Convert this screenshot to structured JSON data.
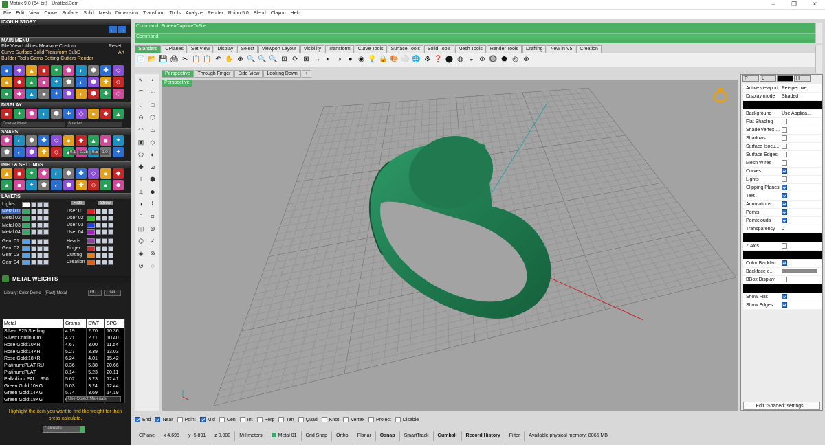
{
  "title": "Matrix 9.0 (64-bit) - Untitled.3dm",
  "window_controls": [
    "–",
    "❐",
    "✕"
  ],
  "menu": [
    "File",
    "Edit",
    "View",
    "Curve",
    "Surface",
    "Solid",
    "Mesh",
    "Dimension",
    "Transform",
    "Tools",
    "Analyze",
    "Render",
    "Rhino 5.0",
    "Blend",
    "Clayoo",
    "Help"
  ],
  "left": {
    "icon_history": "ICON HISTORY",
    "main_menu": "MAIN MENU",
    "main_menu_rows": [
      "File  View  Utilities  Measure  Custom",
      "Curve  Surface  Solid  Transform  SubD",
      "Builder  Tools  Gems  Setting  Cutters  Render"
    ],
    "main_menu_reset": "Reset",
    "main_menu_art": "Art",
    "display": "DISPLAY",
    "display_fields": [
      "Coarse Mesh",
      "Shaded"
    ],
    "snaps": "SNAPS",
    "snap_values": [
      "0.1",
      "0.25",
      "0.5",
      "1.0"
    ],
    "info_settings": "INFO & SETTINGS",
    "layers": "LAYERS",
    "layers_hide": "Hide",
    "layers_show": "Show",
    "layers_left": [
      {
        "name": "Lights",
        "color": "#ffffff",
        "sel": false
      },
      {
        "name": "Metal 01",
        "color": "#3aa66a",
        "sel": true
      },
      {
        "name": "Metal 02",
        "color": "#3aa66a",
        "sel": false
      },
      {
        "name": "Metal 03",
        "color": "#3aa66a",
        "sel": false
      },
      {
        "name": "Metal 04",
        "color": "#3aa66a",
        "sel": false
      },
      {
        "name": "Gem 01",
        "color": "#5aa0e0",
        "sel": false
      },
      {
        "name": "Gem 02",
        "color": "#5aa0e0",
        "sel": false
      },
      {
        "name": "Gem 03",
        "color": "#5aa0e0",
        "sel": false
      },
      {
        "name": "Gem 04",
        "color": "#5aa0e0",
        "sel": false
      }
    ],
    "layers_right": [
      {
        "name": "User 01",
        "color": "#e02020"
      },
      {
        "name": "User 02",
        "color": "#20c020"
      },
      {
        "name": "User 03",
        "color": "#2040e0"
      },
      {
        "name": "User 04",
        "color": "#a020c0"
      },
      {
        "name": "Heads",
        "color": "#9040a0"
      },
      {
        "name": "Finger",
        "color": "#c03030"
      },
      {
        "name": "Cutting",
        "color": "#e08020"
      },
      {
        "name": "Creation",
        "color": "#e06010"
      }
    ],
    "metal_weights": "METAL WEIGHTS",
    "mw_library": "Library: Color Dome - (Fast)-Metal",
    "mw_unit1": "GU",
    "mw_unit2": "User",
    "mw_headers": [
      "Metal",
      "Grams",
      "DWT",
      "SPG"
    ],
    "mw_rows": [
      [
        "Silver:.925 Sterling",
        "4.19",
        "2.70",
        "10.36"
      ],
      [
        "Silver:Continuum",
        "4.21",
        "2.71",
        "10.40"
      ],
      [
        "Rose Gold:10KR",
        "4.67",
        "3.00",
        "11.54"
      ],
      [
        "Rose Gold:14KR",
        "5.27",
        "3.39",
        "13.03"
      ],
      [
        "Rose Gold:18KR",
        "6.24",
        "4.01",
        "15.42"
      ],
      [
        "Platinum:PLAT RU",
        "8.36",
        "5.38",
        "20.66"
      ],
      [
        "Platinum:PLAT",
        "8.14",
        "5.23",
        "20.11"
      ],
      [
        "Palladium:PALL .950",
        "5.02",
        "3.23",
        "12.41"
      ],
      [
        "Green Gold:10KG",
        "5.03",
        "3.24",
        "12.44"
      ],
      [
        "Green Gold:14KG",
        "5.74",
        "3.69",
        "14.19"
      ],
      [
        "Green Gold:18KG",
        "6.44",
        "4.14",
        "15.92"
      ]
    ],
    "use_object_materials": "Use Object Materials",
    "highlight_text": "Highlight the item you want to find the weight for then press calculate.",
    "calculate": "Calculate"
  },
  "command": {
    "line1": "Command: ScreenCaptureToFile",
    "line2": "Command:"
  },
  "tabs": [
    "Standard",
    "CPlanes",
    "Set View",
    "Display",
    "Select",
    "Viewport Layout",
    "Visibility",
    "Transform",
    "Curve Tools",
    "Surface Tools",
    "Solid Tools",
    "Mesh Tools",
    "Render Tools",
    "Drafting",
    "New in V5",
    "Creation"
  ],
  "viewport_tabs": [
    "Perspective",
    "Through Finger",
    "Side View",
    "Looking Down",
    "+"
  ],
  "viewport_label": "Perspective",
  "props": {
    "rows": [
      {
        "label": "Active viewport",
        "value": "Perspective"
      },
      {
        "label": "Display mode",
        "value": "Shaded",
        "dd": true
      },
      {
        "blk": true
      },
      {
        "label": "Background",
        "value": "Use Applica...",
        "dd": true
      },
      {
        "label": "Flat Shading",
        "cb": false
      },
      {
        "label": "Shade vertex ...",
        "cb": false
      },
      {
        "label": "Shadows",
        "cb": false
      },
      {
        "label": "Surface Isocu...",
        "cb": false
      },
      {
        "label": "Surface Edges",
        "cb": false
      },
      {
        "label": "Mesh Wires",
        "cb": false
      },
      {
        "label": "Curves",
        "cb": true
      },
      {
        "label": "Lights",
        "cb": false
      },
      {
        "label": "Clipping Planes",
        "cb": true
      },
      {
        "label": "Text",
        "cb": true
      },
      {
        "label": "Annotations",
        "cb": true
      },
      {
        "label": "Points",
        "cb": true
      },
      {
        "label": "Pointclouds",
        "cb": true
      },
      {
        "label": "Transparency",
        "value": "0"
      },
      {
        "blk": true
      },
      {
        "label": "Z Axis",
        "cb": false
      },
      {
        "blk": true
      },
      {
        "label": "Color Backfac...",
        "cb": true
      },
      {
        "label": "Backface c...",
        "swatch": true
      },
      {
        "label": "BBox Display",
        "cb": false
      },
      {
        "blk": true
      },
      {
        "label": "Show Fills",
        "cb": true
      },
      {
        "label": "Show Edges",
        "cb": true
      }
    ],
    "edit_button": "Edit \"Shaded\" settings..."
  },
  "osnap": [
    {
      "label": "End",
      "on": true
    },
    {
      "label": "Near",
      "on": true
    },
    {
      "label": "Point",
      "on": false
    },
    {
      "label": "Mid",
      "on": true
    },
    {
      "label": "Cen",
      "on": false
    },
    {
      "label": "Int",
      "on": false
    },
    {
      "label": "Perp",
      "on": false
    },
    {
      "label": "Tan",
      "on": false
    },
    {
      "label": "Quad",
      "on": false
    },
    {
      "label": "Knot",
      "on": false
    },
    {
      "label": "Vertex",
      "on": false
    },
    {
      "label": "Project",
      "on": false
    },
    {
      "label": "Disable",
      "on": false
    }
  ],
  "status": {
    "cplane": "CPlane",
    "x": "x 4.695",
    "y": "y -5.891",
    "z": "z 0.000",
    "units": "Millimeters",
    "layer": "Metal 01",
    "grid_snap": "Grid Snap",
    "ortho": "Ortho",
    "planar": "Planar",
    "osnap": "Osnap",
    "smarttrack": "SmartTrack",
    "gumball": "Gumball",
    "record_history": "Record History",
    "filter": "Filter",
    "memory": "Available physical memory: 8065 MB"
  },
  "colors": {
    "accent": "#4caf64",
    "ring": "#1f7a4f",
    "layer_sel": "#3c6bc4"
  }
}
